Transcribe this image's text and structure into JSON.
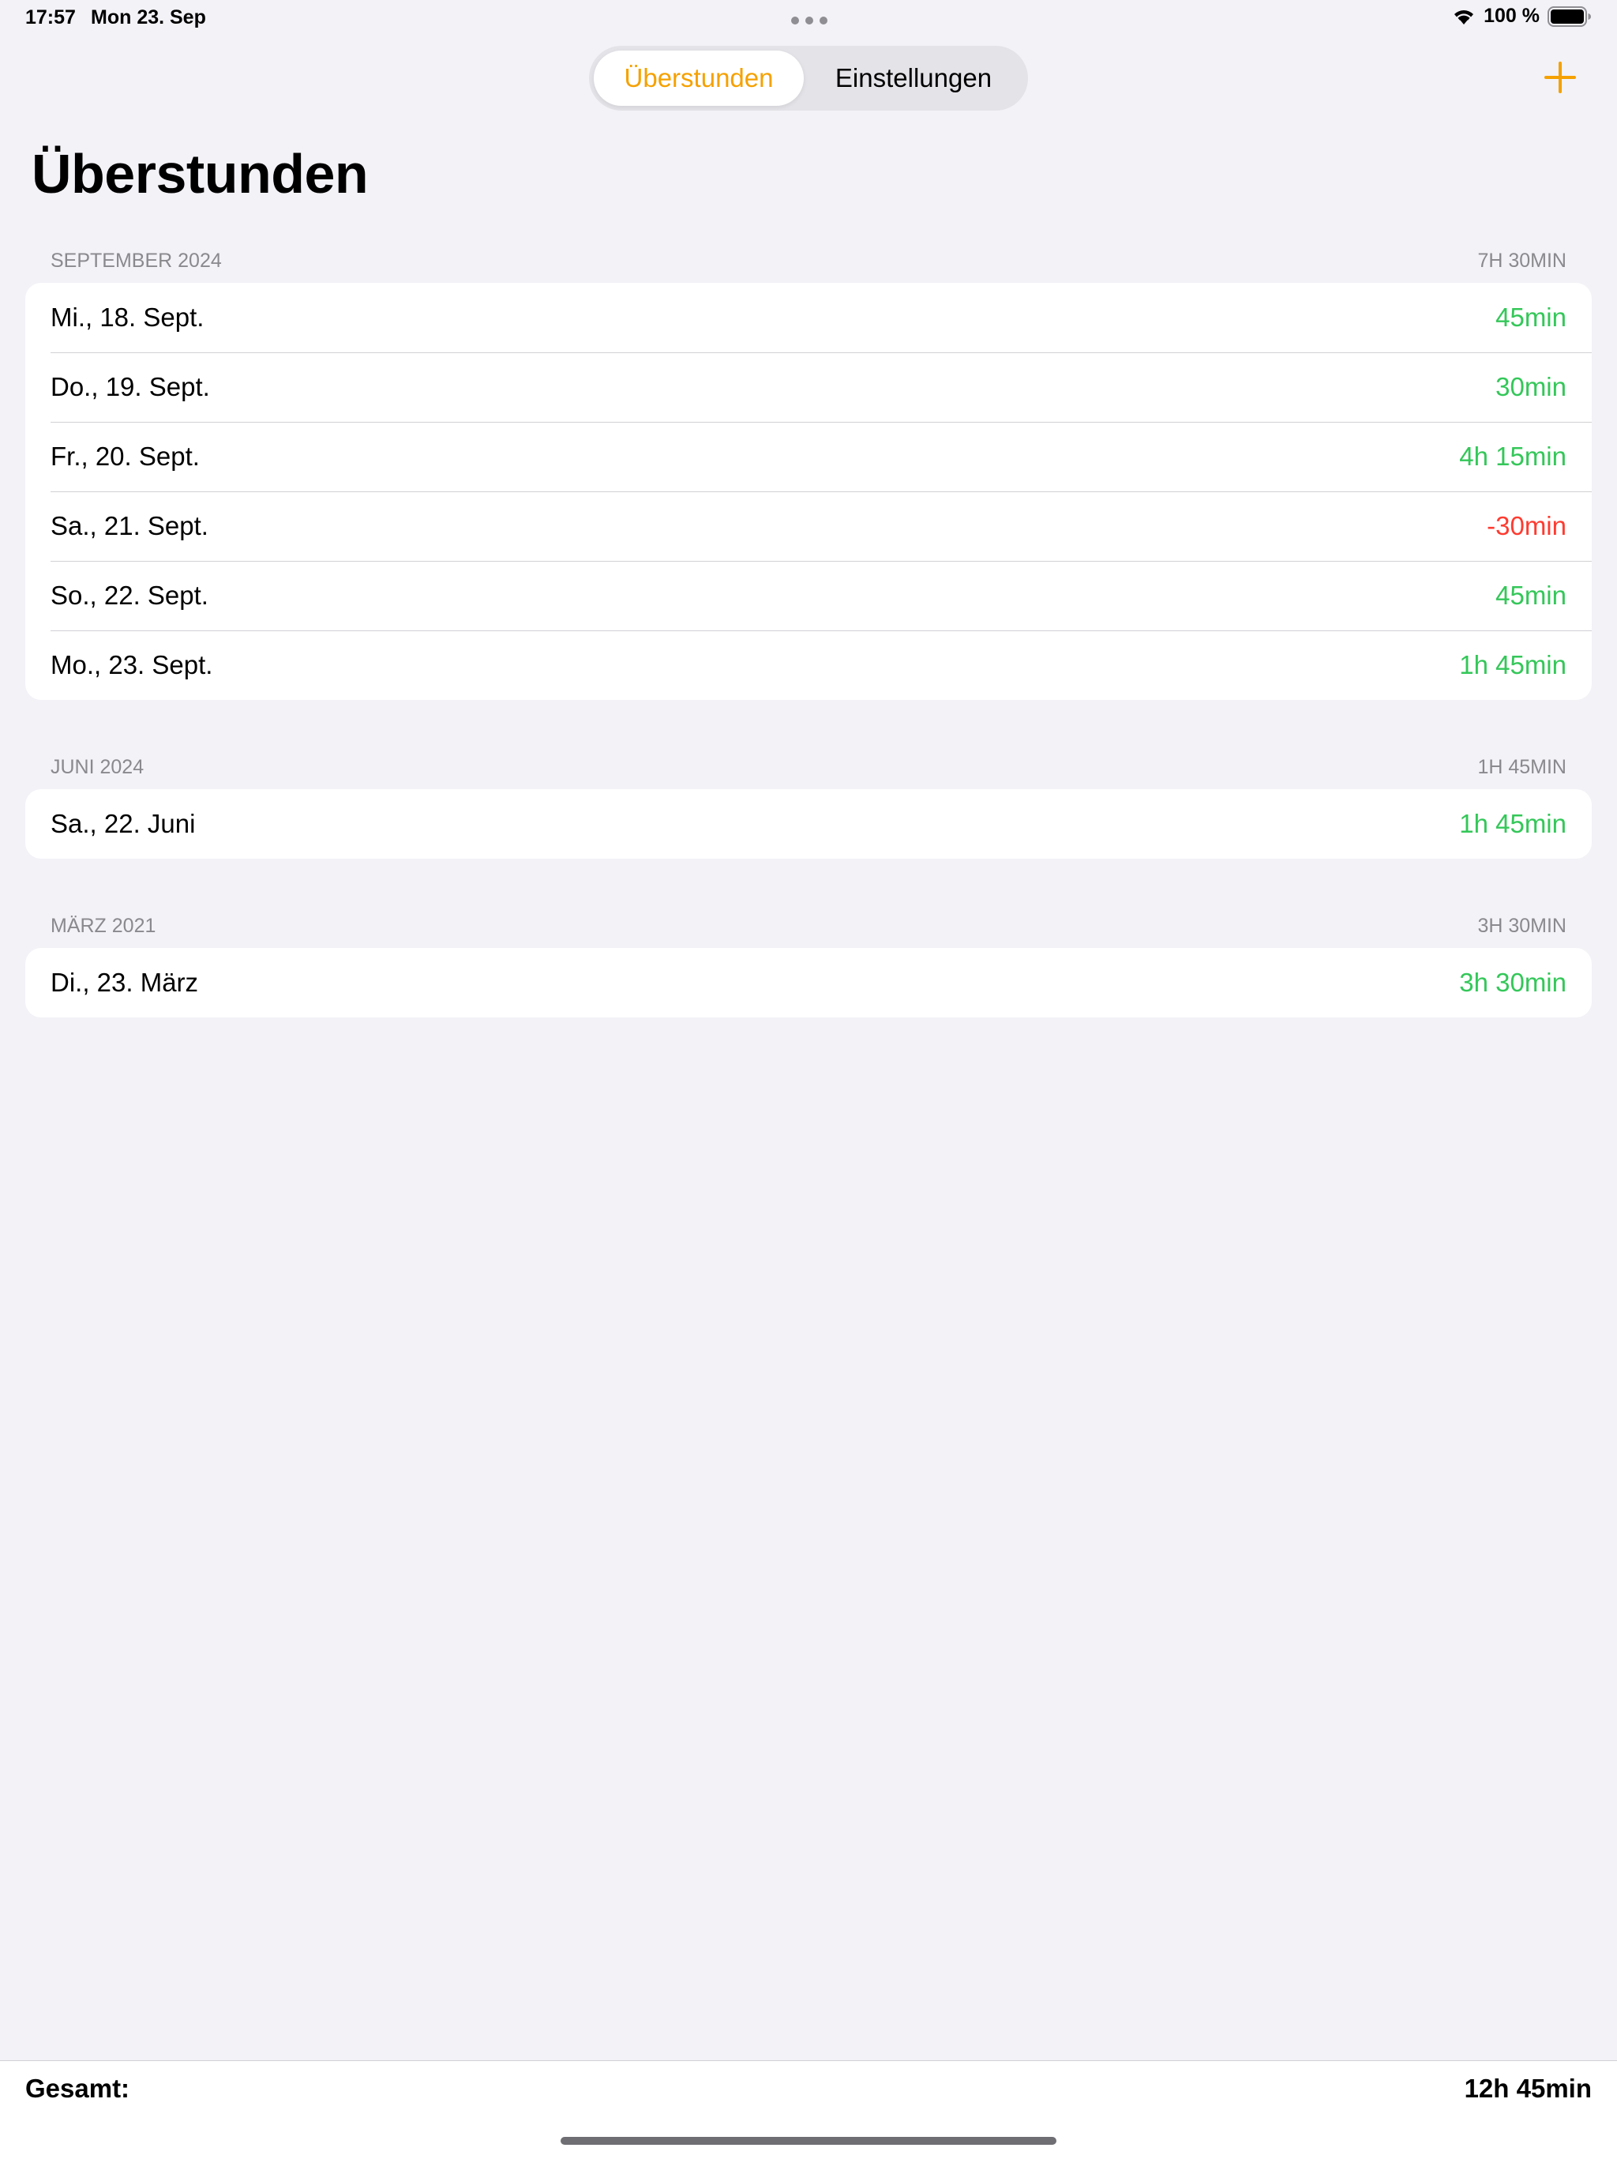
{
  "status_bar": {
    "time": "17:57",
    "date": "Mon 23. Sep",
    "battery": "100 %"
  },
  "nav": {
    "segments": [
      "Überstunden",
      "Einstellungen"
    ],
    "selected_segment": "Überstunden",
    "add_icon": "plus-icon"
  },
  "title": "Überstunden",
  "colors": {
    "accent": "#f5a100",
    "positive": "#34c759",
    "negative": "#ff3b30"
  },
  "sections": [
    {
      "header": "SEPTEMBER 2024",
      "total": "7H 30MIN",
      "rows": [
        {
          "date": "Mi., 18. Sept.",
          "value": "45min"
        },
        {
          "date": "Do., 19. Sept.",
          "value": "30min"
        },
        {
          "date": "Fr., 20. Sept.",
          "value": "4h 15min"
        },
        {
          "date": "Sa., 21. Sept.",
          "value": "-30min"
        },
        {
          "date": "So., 22. Sept.",
          "value": "45min"
        },
        {
          "date": "Mo., 23. Sept.",
          "value": "1h 45min"
        }
      ]
    },
    {
      "header": "JUNI 2024",
      "total": "1H 45MIN",
      "rows": [
        {
          "date": "Sa., 22. Juni",
          "value": "1h 45min"
        }
      ]
    },
    {
      "header": "MÄRZ 2021",
      "total": "3H 30MIN",
      "rows": [
        {
          "date": "Di., 23. März",
          "value": "3h 30min"
        }
      ]
    }
  ],
  "footer": {
    "label": "Gesamt:",
    "value": "12h 45min"
  }
}
